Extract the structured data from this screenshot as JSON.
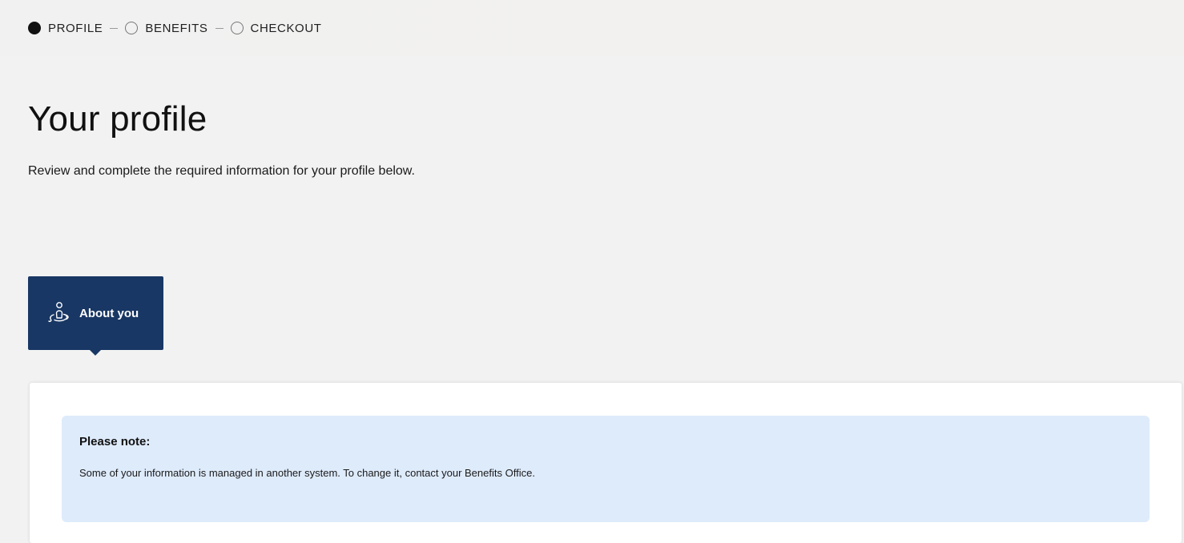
{
  "stepper": {
    "steps": [
      {
        "label": "PROFILE",
        "state": "active"
      },
      {
        "label": "BENEFITS",
        "state": "inactive"
      },
      {
        "label": "CHECKOUT",
        "state": "inactive"
      }
    ]
  },
  "header": {
    "title": "Your profile",
    "subtitle": "Review and complete the required information for your profile below."
  },
  "tabs": [
    {
      "label": "About you",
      "icon": "person-journey-icon",
      "selected": true
    }
  ],
  "notice": {
    "title": "Please note:",
    "message": "Some of your information is managed in another system. To change it, contact your Benefits Office."
  },
  "colors": {
    "tab_bg": "#183764",
    "notice_bg": "#deebfb",
    "page_bg": "#f2f2f2"
  }
}
